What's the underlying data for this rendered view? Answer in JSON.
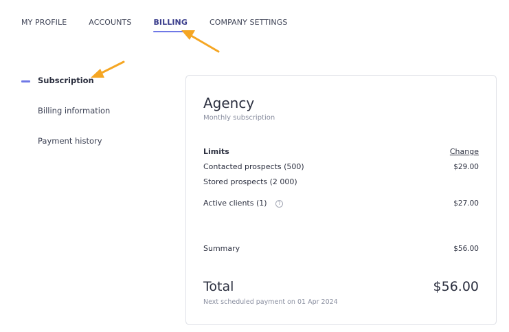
{
  "tabs": [
    {
      "label": "MY PROFILE"
    },
    {
      "label": "ACCOUNTS"
    },
    {
      "label": "BILLING",
      "active": true
    },
    {
      "label": "COMPANY SETTINGS"
    }
  ],
  "sidebar": {
    "items": [
      {
        "label": "Subscription",
        "active": true
      },
      {
        "label": "Billing information"
      },
      {
        "label": "Payment history"
      }
    ]
  },
  "card": {
    "plan_name": "Agency",
    "plan_type": "Monthly subscription",
    "limits_label": "Limits",
    "change_label": "Change",
    "lines": [
      {
        "label": "Contacted prospects (500)",
        "amount": "$29.00"
      },
      {
        "label": "Stored prospects (2 000)",
        "amount": ""
      },
      {
        "label": "Active clients (1)",
        "amount": "$27.00",
        "help_icon": "?"
      }
    ],
    "summary_label": "Summary",
    "summary_amount": "$56.00",
    "total_label": "Total",
    "total_amount": "$56.00",
    "next_payment": "Next scheduled payment on 01 Apr 2024"
  },
  "colors": {
    "accent": "#6f78e6",
    "annotation_arrow": "#f5a623"
  }
}
